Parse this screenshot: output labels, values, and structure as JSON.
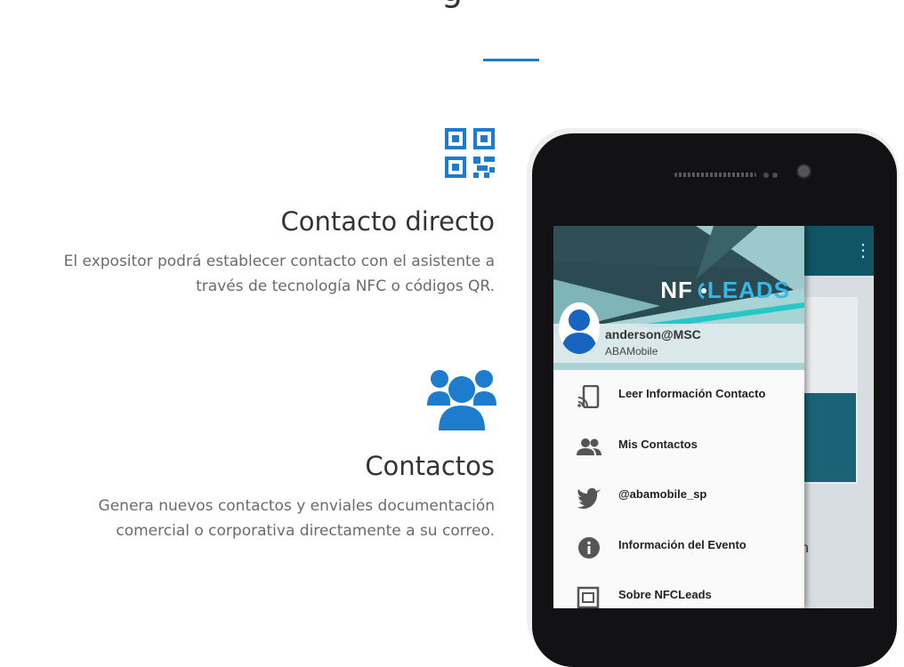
{
  "features": [
    {
      "icon": "qr-code-icon",
      "title": "Contacto directo",
      "description_line1": "El expositor podrá establecer contacto con el asistente a",
      "description_line2": "través de tecnología NFC o códigos QR."
    },
    {
      "icon": "users-group-icon",
      "title": "Contactos",
      "description_line1": "Genera nuevos contactos y enviales documentación",
      "description_line2": "comercial o corporativa directamente a su correo."
    }
  ],
  "phone": {
    "app": {
      "logo_part1": "NF",
      "logo_part2": "LEADS",
      "user_name": "anderson@MSC",
      "user_org": "ABAMobile",
      "background_glyph": "n",
      "menu": [
        {
          "icon": "nfc-read-icon",
          "label": "Leer Información Contacto"
        },
        {
          "icon": "contacts-icon",
          "label": "Mis Contactos"
        },
        {
          "icon": "twitter-icon",
          "label": "@abamobile_sp"
        },
        {
          "icon": "info-icon",
          "label": "Información del Evento"
        },
        {
          "icon": "about-icon",
          "label": "Sobre NFCLeads"
        }
      ]
    }
  },
  "colors": {
    "accent": "#1e7ccf",
    "app_bar": "#0f5566",
    "logo_accent": "#37b6e8"
  }
}
